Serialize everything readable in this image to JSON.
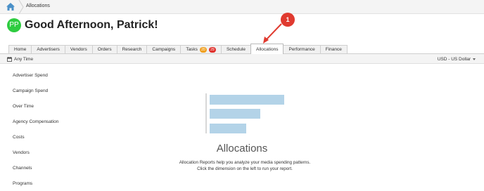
{
  "breadcrumb": {
    "current": "Allocations"
  },
  "user": {
    "initials": "PP",
    "greeting": "Good Afternoon, Patrick!"
  },
  "tabs": [
    {
      "label": "Home"
    },
    {
      "label": "Advertisers"
    },
    {
      "label": "Vendors"
    },
    {
      "label": "Orders"
    },
    {
      "label": "Research"
    },
    {
      "label": "Campaigns"
    },
    {
      "label": "Tasks",
      "badges": [
        "20",
        "29"
      ]
    },
    {
      "label": "Schedule"
    },
    {
      "label": "Allocations",
      "active": true
    },
    {
      "label": "Performance"
    },
    {
      "label": "Finance"
    }
  ],
  "filter": {
    "time": "Any Time",
    "currency": "USD - US Dollar"
  },
  "sidebar": {
    "items": [
      {
        "label": "Advertiser Spend"
      },
      {
        "label": "Campaign Spend"
      },
      {
        "label": "Over Time"
      },
      {
        "label": "Agency Compensation"
      },
      {
        "label": "Costs"
      },
      {
        "label": "Vendors"
      },
      {
        "label": "Channels"
      },
      {
        "label": "Programs"
      }
    ]
  },
  "main": {
    "title": "Allocations",
    "description": "Allocation Reports help you analyze your media spending patterns. Click the dimension on the left to run your report."
  },
  "callout": {
    "number": "1"
  },
  "colors": {
    "accent": "#e03a2f",
    "avatar": "#2ecc40",
    "bars": "#b3d3e8"
  }
}
